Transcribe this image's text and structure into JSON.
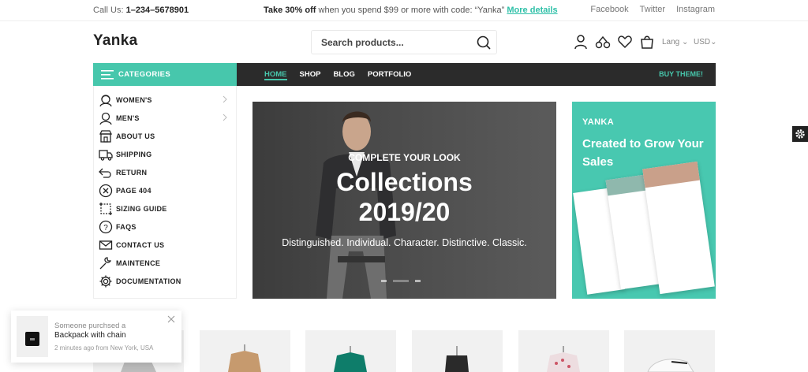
{
  "topbar": {
    "call_prefix": "Call Us:",
    "call_number": "1–234–5678901",
    "promo_bold": "Take 30% off",
    "promo_text": "when you spend $99 or more with code: “Yanka”",
    "promo_link": "More details",
    "social": [
      "Facebook",
      "Twitter",
      "Instagram"
    ]
  },
  "header": {
    "logo": "Yanka",
    "search_placeholder": "Search products...",
    "icons": [
      "user-icon",
      "compare-icon",
      "heart-icon",
      "cart-icon"
    ],
    "lang": "Lang",
    "currency": "USD"
  },
  "nav": {
    "categories_label": "CATEGORIES",
    "menu": [
      {
        "label": "HOME",
        "active": true
      },
      {
        "label": "SHOP",
        "active": false
      },
      {
        "label": "BLOG",
        "active": false
      },
      {
        "label": "PORTFOLIO",
        "active": false
      }
    ],
    "buy": "BUY THEME!"
  },
  "sidebar": {
    "items": [
      {
        "label": "WOMEN'S",
        "icon": "woman-icon",
        "submenu": true
      },
      {
        "label": "MEN'S",
        "icon": "man-icon",
        "submenu": true
      },
      {
        "label": "ABOUT US",
        "icon": "store-icon",
        "submenu": false
      },
      {
        "label": "SHIPPING",
        "icon": "truck-icon",
        "submenu": false
      },
      {
        "label": "RETURN",
        "icon": "return-icon",
        "submenu": false
      },
      {
        "label": "PAGE 404",
        "icon": "close-circle-icon",
        "submenu": false
      },
      {
        "label": "SIZING GUIDE",
        "icon": "crop-icon",
        "submenu": false
      },
      {
        "label": "FAQS",
        "icon": "question-icon",
        "submenu": false
      },
      {
        "label": "CONTACT US",
        "icon": "mail-icon",
        "submenu": false
      },
      {
        "label": "MAINTENCE",
        "icon": "wrench-icon",
        "submenu": false
      },
      {
        "label": "DOCUMENTATION",
        "icon": "gear-icon",
        "submenu": false
      }
    ]
  },
  "hero": {
    "kicker": "COMPLETE YOUR LOOK",
    "title1": "Collections",
    "title2": "2019/20",
    "subtitle": "Distinguished. Individual. Character. Distinctive. Classic."
  },
  "promo_card": {
    "brand": "YANKA",
    "headline": "Created to Grow Your Sales"
  },
  "toast": {
    "line1": "Someone purchsed a",
    "product": "Backpack with chain",
    "meta": "2 minutes ago from New York, USA"
  },
  "colors": {
    "accent": "#47c7ac",
    "nav_bg": "#2b2b2b"
  }
}
